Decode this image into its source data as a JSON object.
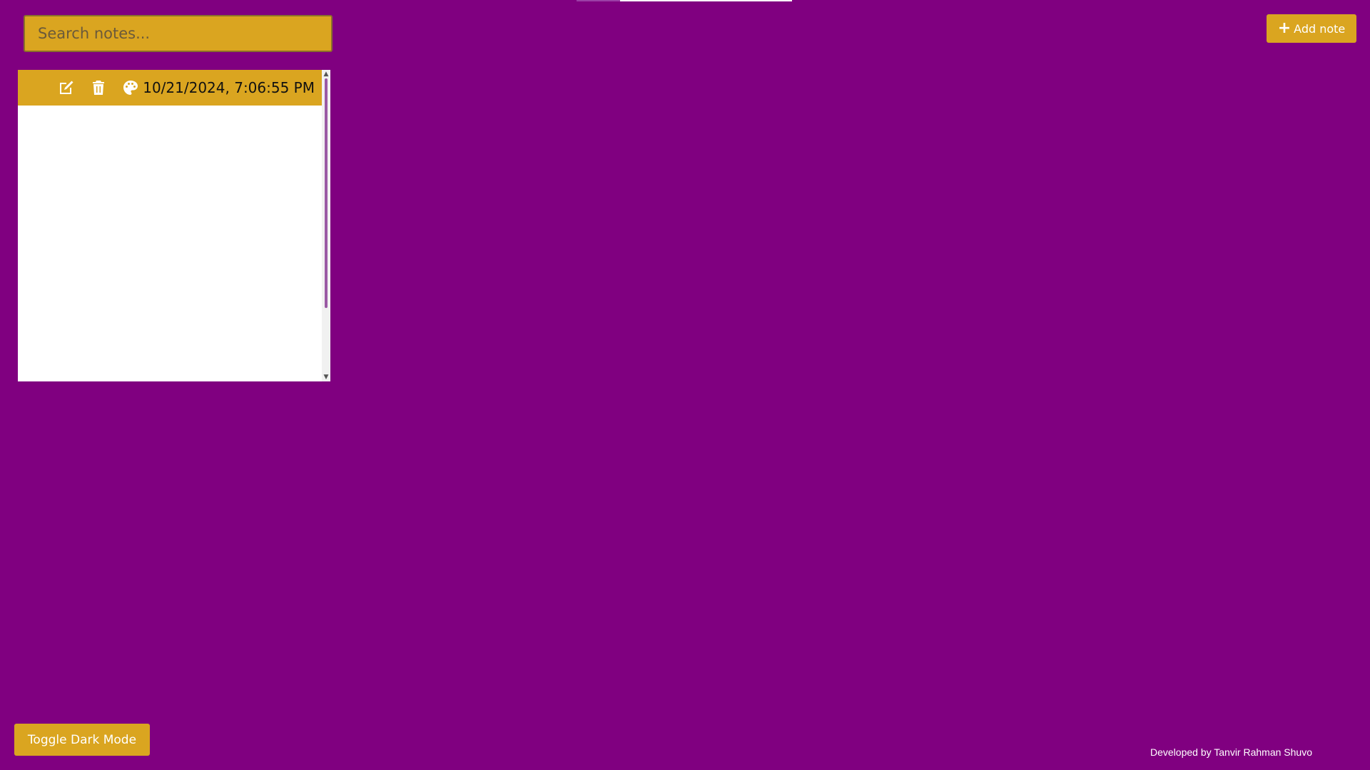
{
  "search": {
    "placeholder": "Search notes..."
  },
  "header": {
    "add_note_label": "Add note",
    "add_note_icon": "plus-icon"
  },
  "notes": [
    {
      "date": "10/21/2024, 7:06:55 PM",
      "content": "",
      "toolbar_icons": [
        "edit-icon",
        "trash-icon",
        "palette-icon"
      ]
    }
  ],
  "footer": {
    "toggle_dark_label": "Toggle Dark Mode",
    "credit": "Developed by Tanvir Rahman Shuvo"
  },
  "colors": {
    "background": "#800080",
    "accent": "#daa520",
    "text_light": "#ffffff"
  }
}
